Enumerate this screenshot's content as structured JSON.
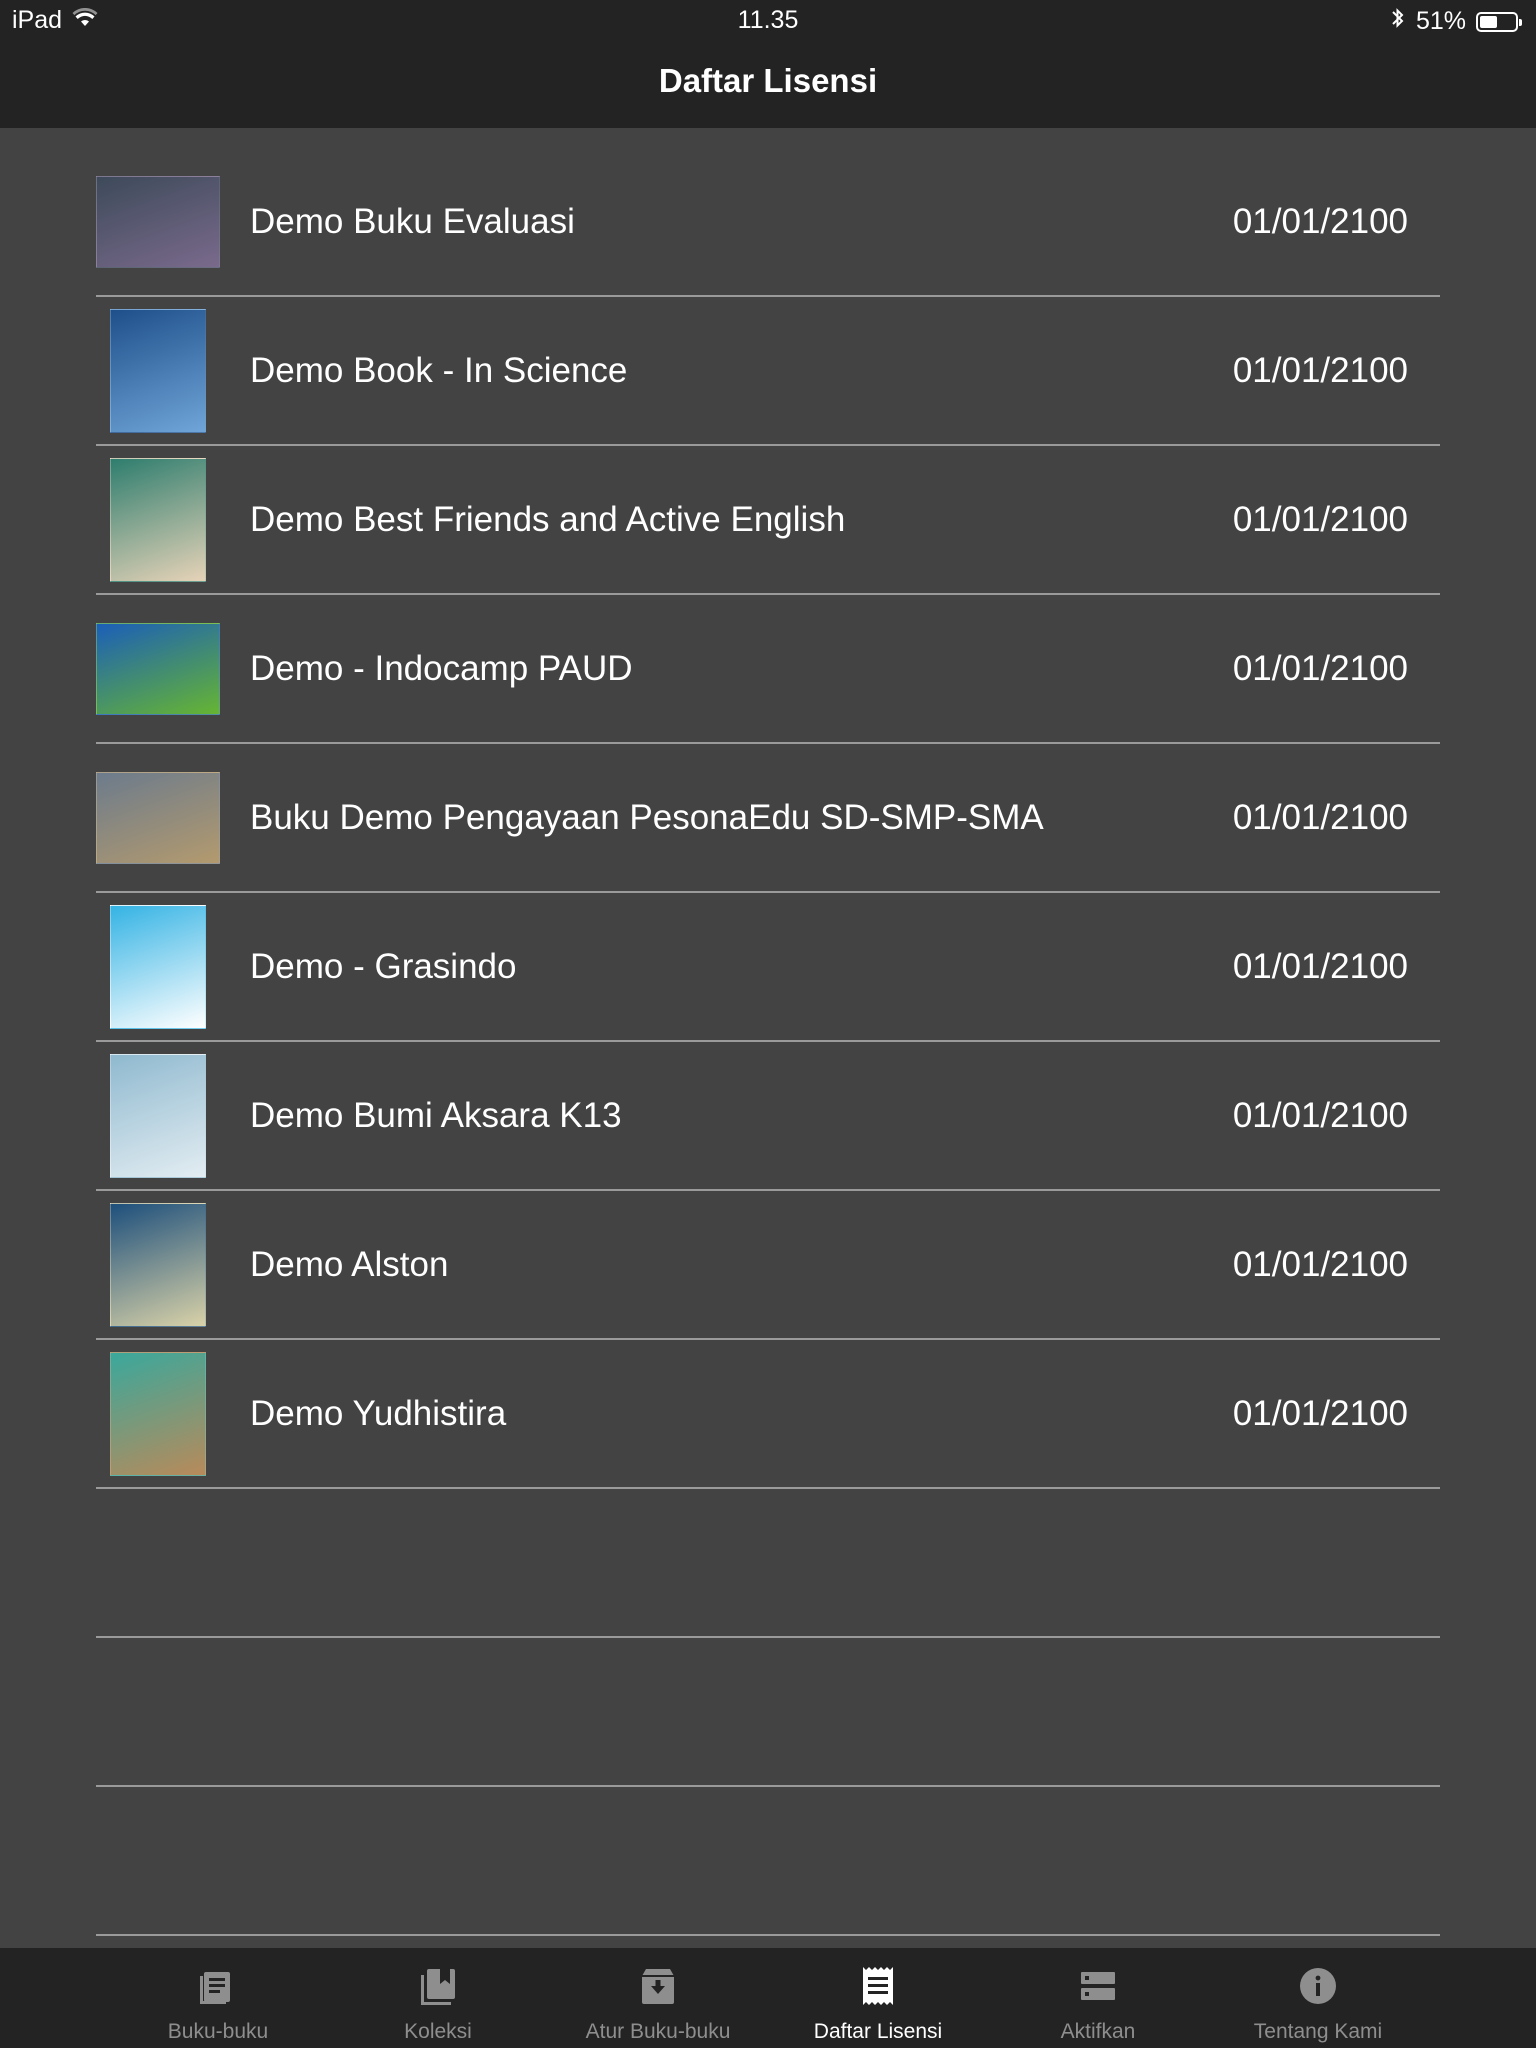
{
  "status_bar": {
    "device": "iPad",
    "time": "11.35",
    "battery": "51%",
    "battery_level": 0.51,
    "icons": [
      "wifi-icon",
      "bluetooth-icon",
      "battery-icon"
    ]
  },
  "header": {
    "title": "Daftar Lisensi"
  },
  "licenses": [
    {
      "title": "Demo Buku Evaluasi",
      "date": "01/01/2100",
      "cover_colors": [
        "#3d4a5a",
        "#7a6a8c"
      ],
      "cover_shape": "landscape"
    },
    {
      "title": "Demo Book - In Science",
      "date": "01/01/2100",
      "cover_colors": [
        "#1f4f8a",
        "#6fa5d8"
      ],
      "cover_shape": "portrait"
    },
    {
      "title": "Demo Best Friends and Active English",
      "date": "01/01/2100",
      "cover_colors": [
        "#2e7d6e",
        "#e6d3b8"
      ],
      "cover_shape": "portrait"
    },
    {
      "title": "Demo - Indocamp PAUD",
      "date": "01/01/2100",
      "cover_colors": [
        "#1b5fb8",
        "#66b532"
      ],
      "cover_shape": "landscape"
    },
    {
      "title": "Buku Demo Pengayaan PesonaEdu SD-SMP-SMA",
      "date": "01/01/2100",
      "cover_colors": [
        "#6c7b8c",
        "#b39a6e"
      ],
      "cover_shape": "landscape"
    },
    {
      "title": "Demo - Grasindo",
      "date": "01/01/2100",
      "cover_colors": [
        "#34b3e4",
        "#ffffff"
      ],
      "cover_shape": "portrait"
    },
    {
      "title": "Demo Bumi Aksara K13",
      "date": "01/01/2100",
      "cover_colors": [
        "#8fb9cf",
        "#e3edf2"
      ],
      "cover_shape": "portrait"
    },
    {
      "title": "Demo Alston",
      "date": "01/01/2100",
      "cover_colors": [
        "#1d4f7c",
        "#d9d2a8"
      ],
      "cover_shape": "portrait"
    },
    {
      "title": "Demo Yudhistira",
      "date": "01/01/2100",
      "cover_colors": [
        "#3aa89c",
        "#b88a5a"
      ],
      "cover_shape": "portrait"
    }
  ],
  "empty_rows": 3,
  "tabs": [
    {
      "label": "Buku-buku",
      "icon": "book-list-icon",
      "active": false
    },
    {
      "label": "Koleksi",
      "icon": "collection-icon",
      "active": false
    },
    {
      "label": "Atur Buku-buku",
      "icon": "archive-icon",
      "active": false
    },
    {
      "label": "Daftar Lisensi",
      "icon": "receipt-icon",
      "active": true
    },
    {
      "label": "Aktifkan",
      "icon": "storage-icon",
      "active": false
    },
    {
      "label": "Tentang Kami",
      "icon": "info-icon",
      "active": false
    }
  ],
  "colors": {
    "background": "#434343",
    "bar": "#232323",
    "divider": "#9a9a9a",
    "text": "#ffffff",
    "tab_inactive": "#8e8e8e"
  }
}
